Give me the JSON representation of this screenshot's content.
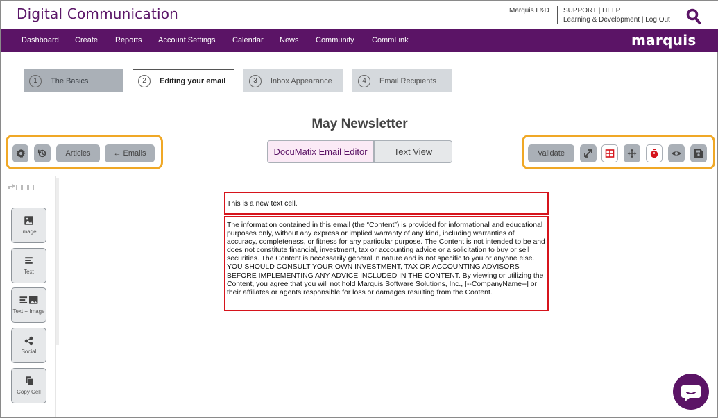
{
  "header": {
    "app_title": "Digital Communication",
    "account": "Marquis L&D",
    "support": "SUPPORT",
    "help": "HELP",
    "learning": "Learning & Development",
    "logout": "Log Out",
    "sep": "|"
  },
  "nav": {
    "items": [
      "Dashboard",
      "Create",
      "Reports",
      "Account Settings",
      "Calendar",
      "News",
      "Community",
      "CommLink"
    ],
    "brand": "marquis"
  },
  "steps": [
    {
      "num": "1",
      "label": "The Basics"
    },
    {
      "num": "2",
      "label": "Editing your email"
    },
    {
      "num": "3",
      "label": "Inbox Appearance"
    },
    {
      "num": "4",
      "label": "Email Recipients"
    }
  ],
  "page_title": "May Newsletter",
  "left_toolbar": {
    "settings_icon": "gear-icon",
    "history_icon": "history-icon",
    "articles": "Articles",
    "emails": "← Emails"
  },
  "modes": {
    "editor": "DocuMatix Email Editor",
    "text_view": "Text View"
  },
  "right_toolbar": {
    "validate": "Validate",
    "icons": [
      "expand-icon",
      "grid-icon",
      "move-icon",
      "timer-icon",
      "eye-icon",
      "save-icon"
    ]
  },
  "palette": [
    {
      "label": "Image",
      "icon": "image-icon"
    },
    {
      "label": "Text",
      "icon": "text-icon"
    },
    {
      "label": "Text + Image",
      "icon": "text-image-icon"
    },
    {
      "label": "Social",
      "icon": "share-icon"
    },
    {
      "label": "Copy Cell",
      "icon": "copy-icon"
    }
  ],
  "editor": {
    "cell1_text": "This is a new text cell.",
    "cell2_text": "The information contained in this email (the “Content”) is provided for informational and educational purposes only, without any express or implied warranty of any kind, including warranties of accuracy, completeness, or fitness for any particular purpose. The Content is not intended to be and does not constitute financial, investment, tax or accounting advice or a solicitation to buy or sell securities. The Content is necessarily general in nature and is not specific to you or anyone else. YOU SHOULD CONSULT YOUR OWN INVESTMENT, TAX OR ACCOUNTING ADVISORS BEFORE IMPLEMENTING ANY ADVICE INCLUDED IN THE CONTENT. By viewing or utilizing the Content, you agree that you will not hold Marquis Software Solutions, Inc., [--CompanyName--] or their affiliates or agents responsible for loss or damages resulting from the Content."
  },
  "colors": {
    "brand_purple": "#5b1466",
    "highlight_orange": "#f0a826",
    "cell_border_red": "#d6141c"
  }
}
